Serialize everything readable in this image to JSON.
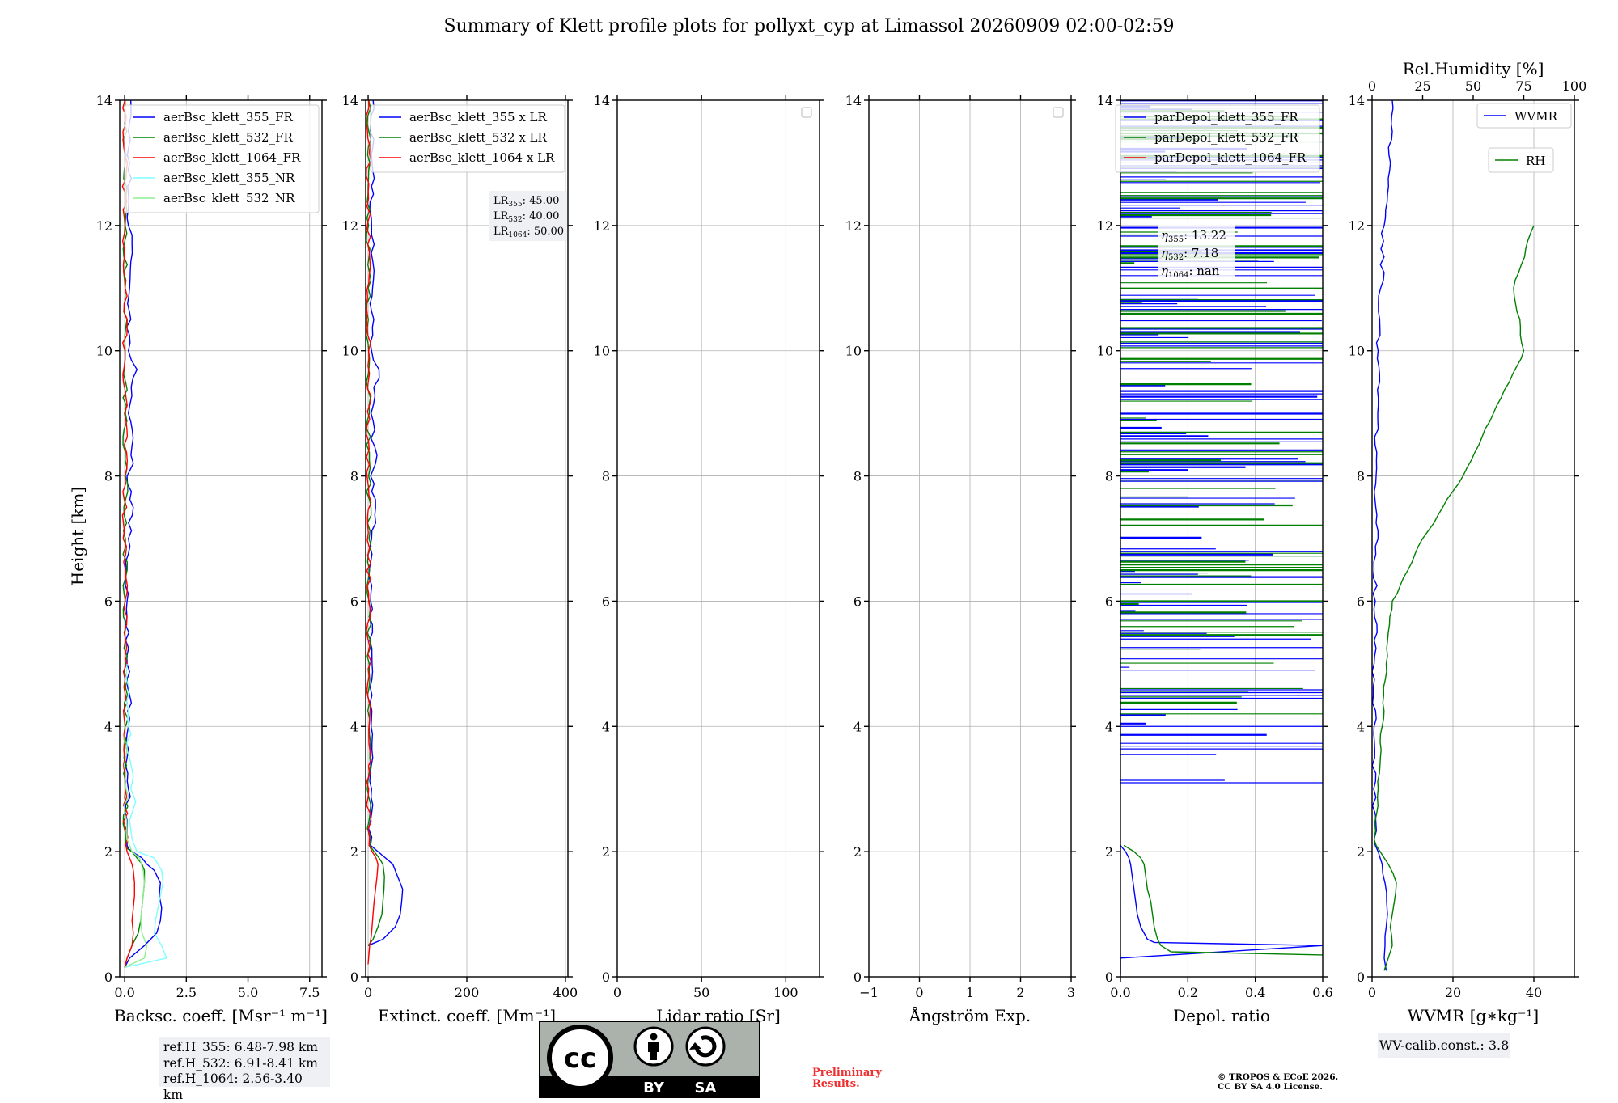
{
  "title": "Summary of Klett profile plots for pollyxt_cyp at Limassol 20260909 02:00-02:59",
  "ref_heights": [
    "ref.H_355: 6.48-7.98 km",
    "ref.H_532: 6.91-8.41 km",
    "ref.H_1064: 2.56-3.40 km"
  ],
  "wv_calib": "WV-calib.const.: 3.8",
  "preliminary": [
    "Preliminary",
    "Results."
  ],
  "copyright": [
    "© TROPOS & ECoE 2026.",
    "CC BY SA 4.0 License."
  ],
  "license_badge": {
    "left": "BY",
    "right": "SA",
    "logo_text": "cc"
  },
  "colors": {
    "blue": "#0000ff",
    "green": "#008000",
    "red": "#ff0000",
    "cyan": "#7fffff",
    "lightgreen": "#90ee90",
    "grid": "#b0b0b0"
  },
  "chart_data": [
    {
      "type": "line",
      "id": "backscatter",
      "xlabel": "Backsc. coeff. [Msr$^{-1}$ m$^{-1}$]",
      "xlabel_display": "Backsc. coeff. [Msr⁻¹ m⁻¹]",
      "ylabel": "Height [km]",
      "xlim": [
        -0.2,
        8.0
      ],
      "ylim": [
        0,
        14
      ],
      "xticks": [
        0.0,
        2.5,
        5.0,
        7.5
      ],
      "xtick_labels": [
        "0.0",
        "2.5",
        "5.0",
        "7.5"
      ],
      "yticks": [
        0,
        2,
        4,
        6,
        8,
        10,
        12,
        14
      ],
      "grid": true,
      "legend": "top-right",
      "series": [
        {
          "name": "aerBsc_klett_355_FR",
          "color": "#0000ff",
          "y": [
            0.15,
            0.3,
            0.5,
            0.7,
            0.9,
            1.1,
            1.3,
            1.5,
            1.7,
            1.8,
            1.9,
            2.0,
            2.05,
            2.1,
            2.2,
            2.5,
            3.0,
            3.5,
            4.0,
            4.5,
            5.0,
            6.0,
            7.0,
            7.5,
            8.0,
            8.2,
            9.0,
            9.7,
            10.0,
            11.0,
            11.7,
            12.0,
            13.0,
            13.5,
            14.0
          ],
          "x": [
            0.0,
            0.2,
            0.8,
            1.3,
            1.45,
            1.5,
            1.4,
            1.45,
            1.2,
            0.9,
            0.7,
            0.3,
            0.15,
            0.1,
            0.1,
            0.1,
            0.15,
            0.1,
            0.15,
            0.2,
            0.1,
            0.1,
            0.15,
            0.35,
            0.1,
            0.35,
            0.15,
            0.5,
            0.15,
            0.2,
            0.3,
            0.15,
            0.2,
            0.15,
            0.25
          ]
        },
        {
          "name": "aerBsc_klett_532_FR",
          "color": "#008000",
          "y": [
            0.15,
            0.3,
            0.5,
            0.7,
            0.9,
            1.1,
            1.3,
            1.5,
            1.7,
            1.8,
            1.9,
            2.0,
            2.05,
            2.1,
            2.3,
            3.0,
            4.0,
            5.0,
            6.0,
            7.0,
            8.0,
            9.0,
            10.0,
            11.0,
            12.0,
            13.0,
            14.0
          ],
          "x": [
            0.0,
            0.1,
            0.3,
            0.55,
            0.65,
            0.7,
            0.75,
            0.8,
            0.8,
            0.7,
            0.5,
            0.3,
            0.1,
            0.05,
            0.03,
            0.03,
            0.04,
            0.04,
            0.03,
            0.03,
            0.03,
            0.03,
            0.02,
            0.02,
            0.02,
            0.02,
            0.02
          ]
        },
        {
          "name": "aerBsc_klett_1064_FR",
          "color": "#ff0000",
          "y": [
            0.15,
            0.3,
            0.5,
            0.7,
            0.9,
            1.1,
            1.3,
            1.5,
            1.7,
            1.8,
            1.9,
            2.0,
            2.1,
            3.0,
            4.0,
            6.0,
            8.0,
            10.0,
            12.0,
            14.0
          ],
          "x": [
            0.0,
            0.1,
            0.3,
            0.35,
            0.3,
            0.35,
            0.4,
            0.4,
            0.35,
            0.3,
            0.2,
            0.1,
            0.05,
            0.02,
            0.02,
            0.01,
            0.01,
            0.01,
            0.01,
            0.01
          ]
        },
        {
          "name": "aerBsc_klett_355_NR",
          "color": "#7fffff",
          "y": [
            0.15,
            0.3,
            0.5,
            0.7,
            0.9,
            1.1,
            1.3,
            1.5,
            1.7,
            1.9,
            2.0,
            2.2,
            2.5,
            2.8,
            3.0,
            3.2,
            3.5,
            4.0,
            4.5,
            5.0
          ],
          "x": [
            0.0,
            1.7,
            1.5,
            1.2,
            1.25,
            1.35,
            1.45,
            1.55,
            1.5,
            1.2,
            0.5,
            0.3,
            0.2,
            0.45,
            0.25,
            0.35,
            0.2,
            0.15,
            0.15,
            0.1
          ]
        },
        {
          "name": "aerBsc_klett_532_NR",
          "color": "#90ee90",
          "y": [
            0.15,
            0.3,
            0.5,
            0.7,
            0.9,
            1.1,
            1.3,
            1.5,
            1.7,
            1.9,
            2.0,
            2.2,
            2.5,
            3.0,
            3.5,
            4.0
          ],
          "x": [
            0.0,
            0.8,
            0.9,
            0.7,
            0.65,
            0.7,
            0.75,
            0.8,
            0.75,
            0.6,
            0.3,
            0.1,
            0.08,
            0.06,
            0.05,
            0.05
          ]
        }
      ]
    },
    {
      "type": "line",
      "id": "extinction",
      "xlabel": "Extinct. coeff. [Mm$^{-1}$]",
      "xlabel_display": "Extinct. coeff. [Mm⁻¹]",
      "xlim": [
        -5,
        405
      ],
      "ylim": [
        0,
        14
      ],
      "xticks": [
        0,
        200,
        400
      ],
      "xtick_labels": [
        "0",
        "200",
        "400"
      ],
      "yticks": [
        0,
        2,
        4,
        6,
        8,
        10,
        12,
        14
      ],
      "grid": true,
      "legend": "top-right",
      "annotation": [
        "LR355: 45.00",
        "LR532: 40.00",
        "LR1064: 50.00"
      ],
      "series": [
        {
          "name": "aerBsc_klett_355 x LR",
          "color": "#0000ff",
          "y": [
            0.5,
            0.6,
            0.8,
            1.0,
            1.2,
            1.4,
            1.5,
            1.6,
            1.8,
            1.9,
            2.0,
            2.1,
            2.5,
            3.0,
            4.0,
            5.0,
            6.0,
            7.0,
            7.5,
            8.0,
            8.2,
            9.0,
            9.7,
            10.0,
            11.0,
            11.7,
            12.0,
            13.0,
            14.0
          ],
          "x": [
            0,
            30,
            55,
            65,
            68,
            70,
            65,
            60,
            50,
            35,
            20,
            5,
            5,
            7,
            6,
            8,
            5,
            7,
            15,
            5,
            15,
            6,
            22,
            7,
            9,
            12,
            7,
            8,
            10
          ]
        },
        {
          "name": "aerBsc_klett_532 x LR",
          "color": "#008000",
          "y": [
            0.5,
            0.6,
            0.8,
            1.0,
            1.2,
            1.4,
            1.6,
            1.8,
            1.9,
            2.0,
            2.1,
            2.5,
            4.0,
            6.0,
            8.0,
            10.0,
            12.0,
            14.0
          ],
          "x": [
            0,
            10,
            20,
            28,
            30,
            32,
            33,
            30,
            22,
            12,
            3,
            2,
            2,
            2,
            1,
            1,
            1,
            1
          ]
        },
        {
          "name": "aerBsc_klett_1064 x LR",
          "color": "#ff0000",
          "y": [
            0.2,
            0.5,
            0.8,
            1.0,
            1.2,
            1.4,
            1.6,
            1.8,
            1.9,
            2.0,
            2.1,
            3.0,
            6.0,
            10.0,
            14.0
          ],
          "x": [
            0,
            3,
            8,
            10,
            12,
            15,
            18,
            20,
            16,
            8,
            2,
            1,
            1,
            1,
            1
          ]
        }
      ]
    },
    {
      "type": "line",
      "id": "lidar_ratio",
      "xlabel": "Lidar ratio [Sr]",
      "xlim": [
        0,
        120
      ],
      "ylim": [
        0,
        14
      ],
      "xticks": [
        0,
        50,
        100
      ],
      "xtick_labels": [
        "0",
        "50",
        "100"
      ],
      "yticks": [
        0,
        2,
        4,
        6,
        8,
        10,
        12,
        14
      ],
      "grid": true,
      "legend": "top-right (empty)",
      "series": []
    },
    {
      "type": "line",
      "id": "angstrom",
      "xlabel": "Ångström Exp.",
      "xlim": [
        -1,
        3
      ],
      "ylim": [
        0,
        14
      ],
      "xticks": [
        -1,
        0,
        1,
        2,
        3
      ],
      "xtick_labels": [
        "−1",
        "0",
        "1",
        "2",
        "3"
      ],
      "yticks": [
        0,
        2,
        4,
        6,
        8,
        10,
        12,
        14
      ],
      "grid": true,
      "legend": "top-right (empty)",
      "series": []
    },
    {
      "type": "line",
      "id": "depol",
      "xlabel": "Depol. ratio",
      "xlim": [
        0,
        0.6
      ],
      "ylim": [
        0,
        14
      ],
      "xticks": [
        0.0,
        0.2,
        0.4,
        0.6
      ],
      "xtick_labels": [
        "0.0",
        "0.2",
        "0.4",
        "0.6"
      ],
      "yticks": [
        0,
        2,
        4,
        6,
        8,
        10,
        12,
        14
      ],
      "grid": true,
      "legend": "top-right",
      "annotation": [
        "η355: 13.22",
        "η532: 7.18",
        "η1064: nan"
      ],
      "series": [
        {
          "name": "parDepol_klett_355_FR",
          "color": "#0000ff",
          "y": [
            0.05,
            0.3,
            0.5,
            0.55,
            0.6,
            0.8,
            1.0,
            1.2,
            1.4,
            1.6,
            1.8,
            1.9,
            2.0,
            2.1
          ],
          "x": [
            0.0,
            0.0,
            0.6,
            0.1,
            0.08,
            0.06,
            0.05,
            0.045,
            0.04,
            0.035,
            0.03,
            0.025,
            0.015,
            0.0
          ],
          "noise_above_km": 3.1,
          "noise_max": 0.6
        },
        {
          "name": "parDepol_klett_532_FR",
          "color": "#008000",
          "y": [
            0.35,
            0.4,
            0.5,
            0.6,
            0.8,
            1.0,
            1.2,
            1.4,
            1.6,
            1.8,
            1.9,
            2.0,
            2.1
          ],
          "x": [
            0.6,
            0.15,
            0.12,
            0.11,
            0.1,
            0.095,
            0.09,
            0.08,
            0.075,
            0.07,
            0.06,
            0.04,
            0.01
          ],
          "noise_above_km": 4.2,
          "noise_max": 0.6
        },
        {
          "name": "parDepol_klett_1064_FR",
          "color": "#ff0000",
          "y": [],
          "x": []
        }
      ]
    },
    {
      "type": "line",
      "id": "water_vapor",
      "xlabel": "WVMR [$g*kg^{-1}$]",
      "xlabel_display": "WVMR [g∗kg⁻¹]",
      "xlim": [
        0,
        50
      ],
      "ylim": [
        0,
        14
      ],
      "xticks": [
        0,
        20,
        40
      ],
      "xtick_labels": [
        "0",
        "20",
        "40"
      ],
      "top_xlabel": "Rel.Humidity [%]",
      "top_xlim": [
        0,
        100
      ],
      "top_xticks": [
        0,
        25,
        50,
        75,
        100
      ],
      "top_xtick_labels": [
        "0",
        "25",
        "50",
        "75",
        "100"
      ],
      "yticks": [
        0,
        2,
        4,
        6,
        8,
        10,
        12,
        14
      ],
      "grid": true,
      "legend": "top-right",
      "series": [
        {
          "name": "WVMR",
          "color": "#0000ff",
          "y": [
            0.1,
            0.3,
            0.5,
            0.8,
            1.0,
            1.2,
            1.5,
            1.8,
            2.0,
            2.1,
            2.2,
            3.0,
            4.0,
            5.0,
            6.0,
            8.0,
            10.0,
            12.0,
            14.0
          ],
          "x": [
            3.5,
            3.0,
            3.2,
            3.5,
            3.8,
            3.6,
            3.2,
            2.5,
            1.5,
            0.8,
            0.5,
            0.4,
            0.5,
            0.5,
            0.8,
            1.0,
            1.5,
            3.0,
            5.0
          ]
        },
        {
          "name": "RH",
          "color": "#008000",
          "axis": "top",
          "y": [
            0.1,
            0.3,
            0.5,
            0.8,
            1.0,
            1.2,
            1.5,
            1.8,
            2.0,
            2.1,
            2.2,
            3.0,
            4.0,
            5.0,
            5.5,
            6.0,
            7.0,
            8.0,
            9.0,
            10.0,
            11.0,
            12.0
          ],
          "x": [
            6,
            8,
            10,
            9,
            10,
            11,
            12,
            8,
            4,
            2,
            1,
            3,
            5,
            7,
            8,
            10,
            25,
            45,
            60,
            75,
            70,
            80
          ]
        }
      ]
    }
  ]
}
